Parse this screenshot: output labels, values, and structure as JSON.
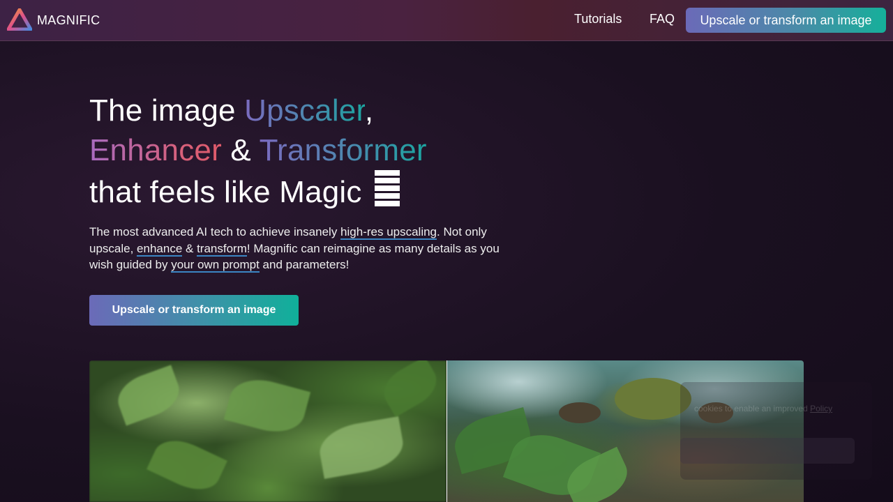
{
  "header": {
    "brand": "MAGNIFIC",
    "nav": {
      "tutorials": "Tutorials",
      "faq": "FAQ"
    },
    "cta_label": "Upscale or transform an image"
  },
  "hero": {
    "title": {
      "line1_a": "The image ",
      "line1_b": "Upscaler",
      "line1_c": ",",
      "line2_a": "Enhancer",
      "line2_b": " & ",
      "line2_c": "Transformer",
      "line3": "that feels like Magic "
    },
    "description": {
      "p1": "The most advanced AI tech to achieve insanely ",
      "link1": "high-res upscaling",
      "p2": ". Not only upscale, ",
      "link2": "enhance",
      "p3": " & ",
      "link3": "transform",
      "p4": "! Magnific can reimagine as many details as you wish guided by ",
      "link4": "your own prompt",
      "p5": " and parameters!"
    },
    "cta_label": "Upscale or transform an image"
  },
  "cookie": {
    "text_a": "cookies to enable an improved",
    "link": "Policy"
  },
  "colors": {
    "accent_start": "#6b6ab8",
    "accent_end": "#10b09a",
    "background": "#1a1020"
  }
}
